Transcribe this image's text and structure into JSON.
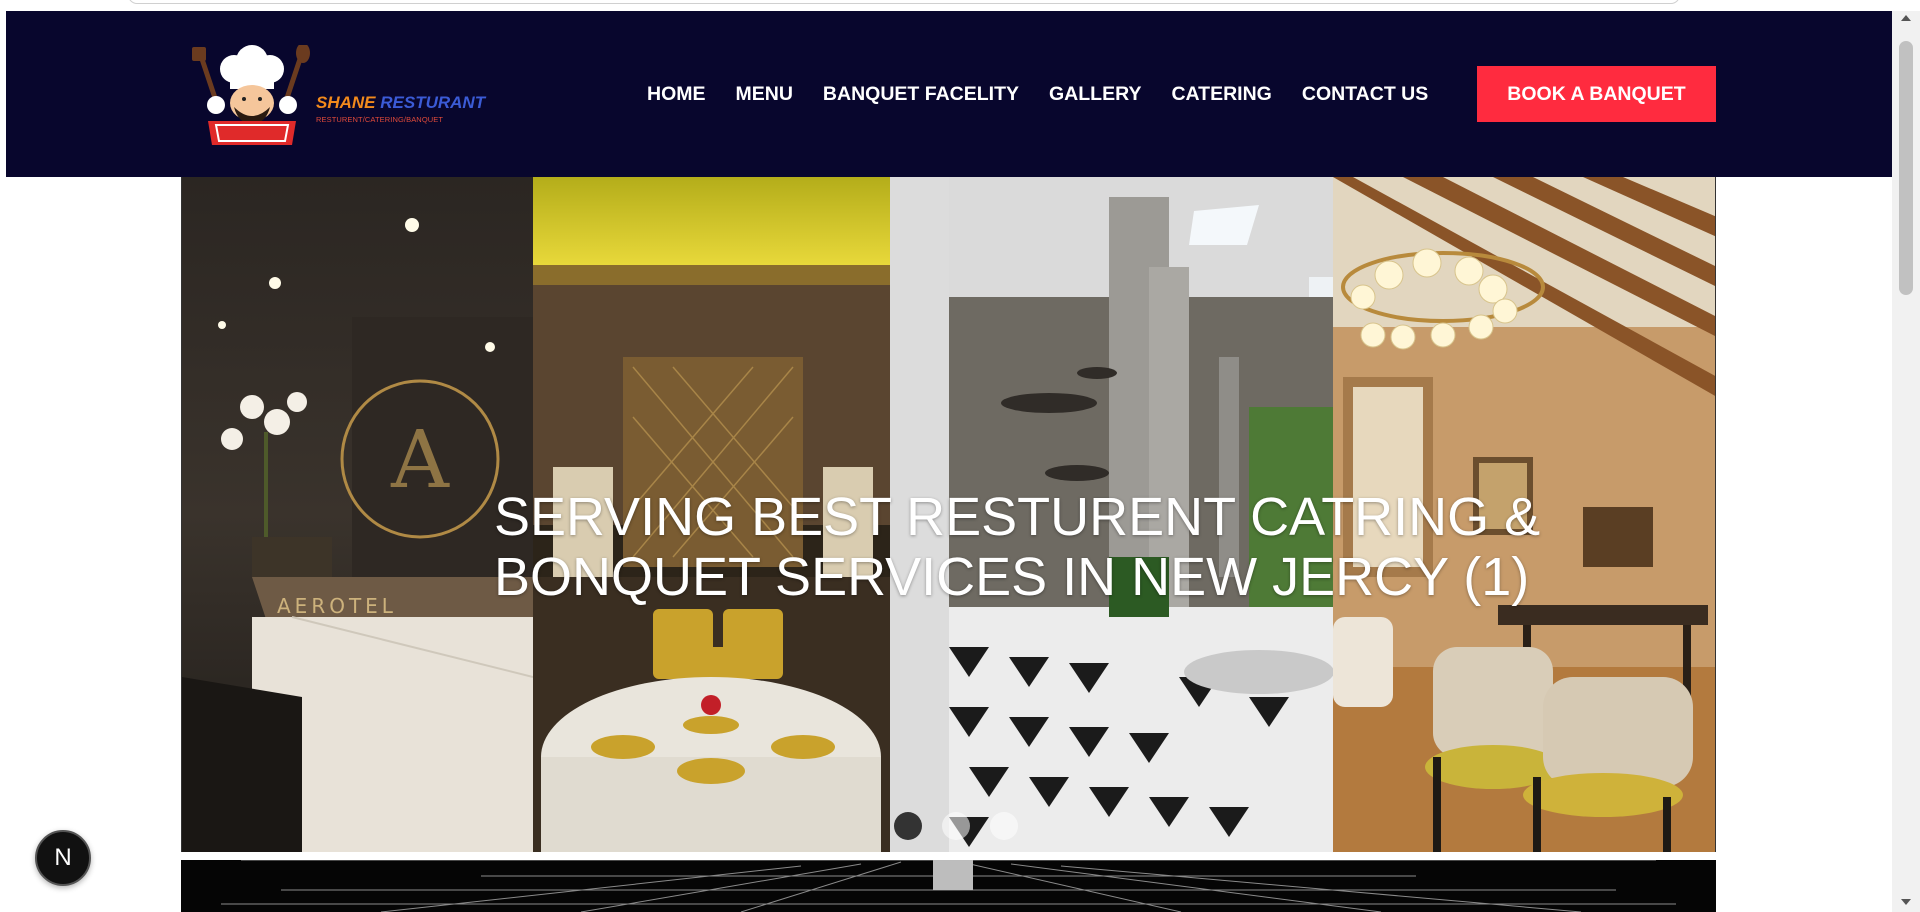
{
  "brand": {
    "name_part1": "SHANE",
    "name_part2": "RESTURANT",
    "tagline": "RESTURENT/CATERING/BANQUET",
    "logo_icon": "chef-logo-icon"
  },
  "nav": {
    "items": [
      {
        "label": "HOME"
      },
      {
        "label": "MENU"
      },
      {
        "label": "BANQUET FACELITY"
      },
      {
        "label": "GALLERY"
      },
      {
        "label": "CATERING"
      },
      {
        "label": "CONTACT US"
      }
    ],
    "cta_label": "BOOK A BANQUET"
  },
  "hero": {
    "title_line1": "SERVING BEST RESTURENT CATRING &",
    "title_line2": "BONQUET SERVICES IN NEW JERCY (1)",
    "slide_count": 3,
    "active_slide": 1,
    "panel_signage": "AEROTEL",
    "panel_sign_letter": "A"
  },
  "floating_badge": {
    "label": "N"
  },
  "colors": {
    "header_bg": "#08062d",
    "cta_bg": "#ff2b3f",
    "brand_orange": "#f28a1c",
    "brand_blue": "#3b5bd6",
    "tagline_red": "#e04a3a"
  }
}
